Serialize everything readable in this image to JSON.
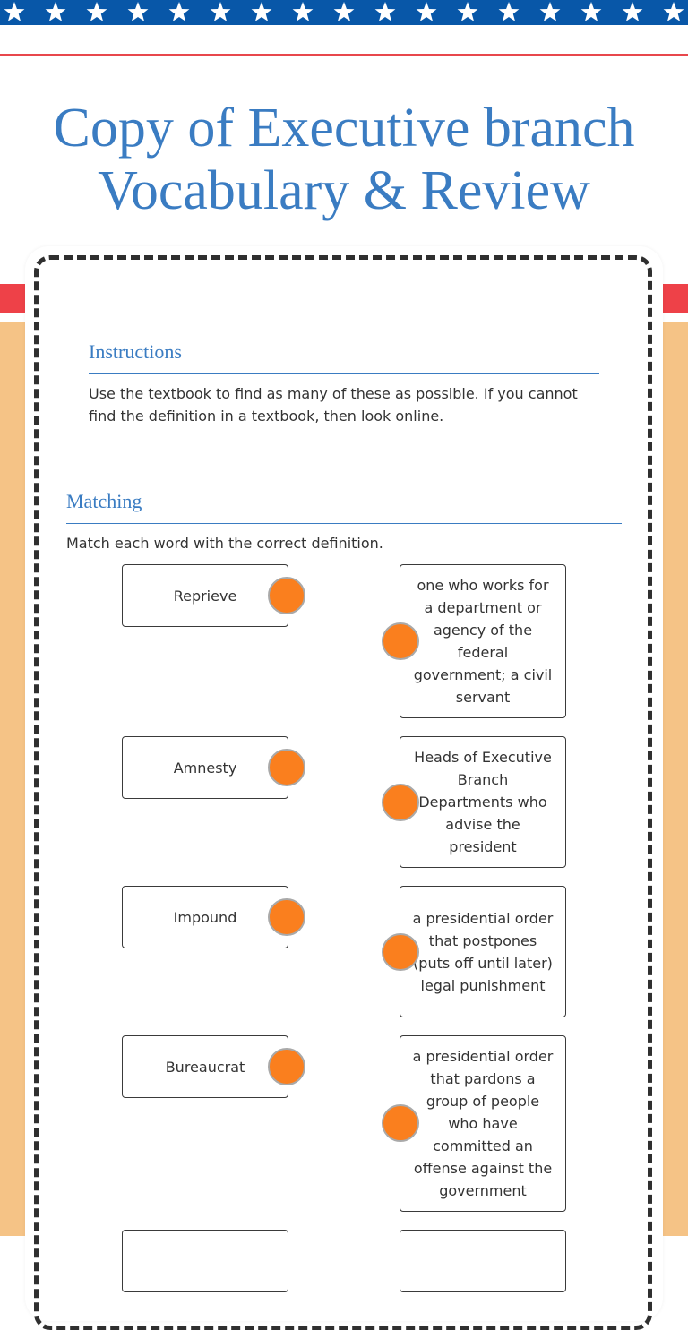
{
  "header": {
    "star_icon": "star-icon",
    "star_count": 17,
    "title_line1": "Copy of Executive branch",
    "title_line2": "Vocabulary & Review"
  },
  "colors": {
    "blue": "#0857a8",
    "title_blue": "#3a7cc2",
    "red": "#ee4148",
    "orange_bg": "#f5c386",
    "dot_orange": "#fa7f1e"
  },
  "instructions": {
    "heading": "Instructions",
    "text": "Use the textbook to find as many of these as possible. If you cannot find the definition in a textbook, then look online."
  },
  "matching": {
    "heading": "Matching",
    "prompt": "Match each word with the correct definition.",
    "terms": [
      "Reprieve",
      "Amnesty",
      "Impound",
      "Bureaucrat",
      ""
    ],
    "definitions": [
      "one who works for a department or agency of the federal government; a civil servant",
      "Heads of Executive Branch Departments who advise the president",
      "a presidential order that postpones (puts off until later) legal punishment",
      "a presidential order that pardons a group of people who have committed an offense against the government",
      ""
    ]
  }
}
